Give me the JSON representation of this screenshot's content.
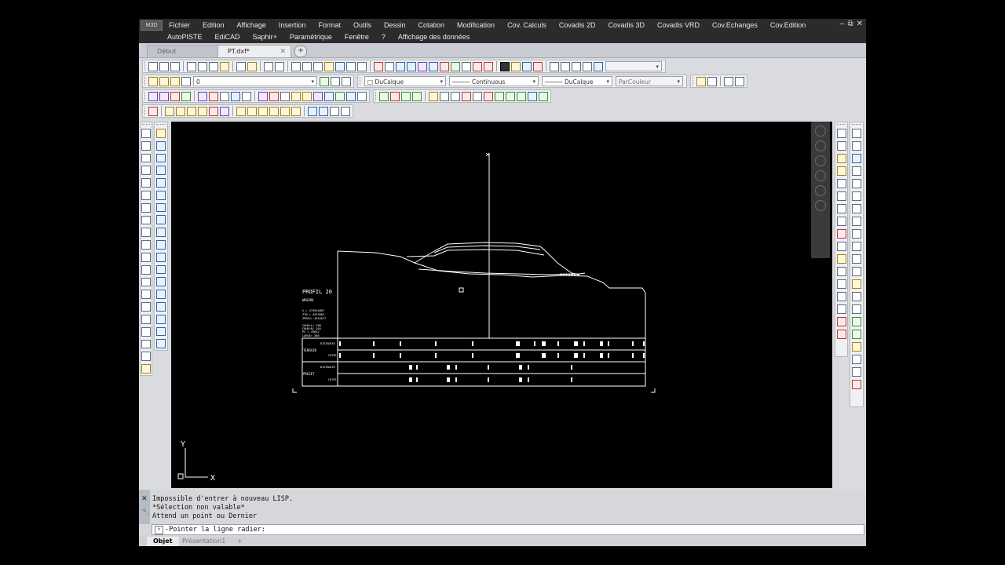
{
  "menus": {
    "row1": [
      "Fichier",
      "Edition",
      "Affichage",
      "Insertion",
      "Format",
      "Outils",
      "Dessin",
      "Cotation",
      "Modification",
      "Cov. Calculs",
      "Covadis 2D",
      "Covadis 3D",
      "Covadis VRD",
      "Cov.Echanges",
      "Cov.Edition"
    ],
    "row2": [
      "AutoPISTE",
      "EdiCAD",
      "Saphir+",
      "Paramétrique",
      "Fenêtre",
      "?",
      "Affichage des données"
    ]
  },
  "app_logo": "M3D",
  "window_controls": [
    "‒",
    "⧉",
    "✕"
  ],
  "file_tabs": [
    "Début",
    "PT.dxf*"
  ],
  "layer_toolbar": {
    "current_layer": "0",
    "color": "DuCalque",
    "linetype": "Continuous",
    "lineweight": "DuCalque",
    "plotstyle": "ParCouleur"
  },
  "drawing": {
    "profile_title": "PROFIL   20",
    "profile_sub": "WKGURO",
    "info_lines": [
      "X  =  474944807",
      "ZTN =  4353063",
      "ZPROJ=  4354677",
      "COHE=L/  208",
      "COHE=R/  204",
      "PC  =  43652",
      "LARGE= 380"
    ],
    "section_labels": [
      "TERRAIN",
      "PROJET"
    ],
    "row_labels": [
      "DISTANCES",
      "COTES",
      "DISTANCES",
      "COTES"
    ],
    "axis_y": "Y",
    "axis_x": "X",
    "mark_x": "×"
  },
  "command": {
    "history": [
      "Impossible d'entrer à nouveau LISP.",
      "*Sélection non valable*",
      "Attend un point ou Dernier"
    ],
    "prompt": "-Pointer la ligne radier:",
    "close_icon": "✕",
    "tool_icon": "🔧"
  },
  "layout_tabs": [
    "Objet",
    "Présentation1"
  ],
  "add_tab": "+"
}
